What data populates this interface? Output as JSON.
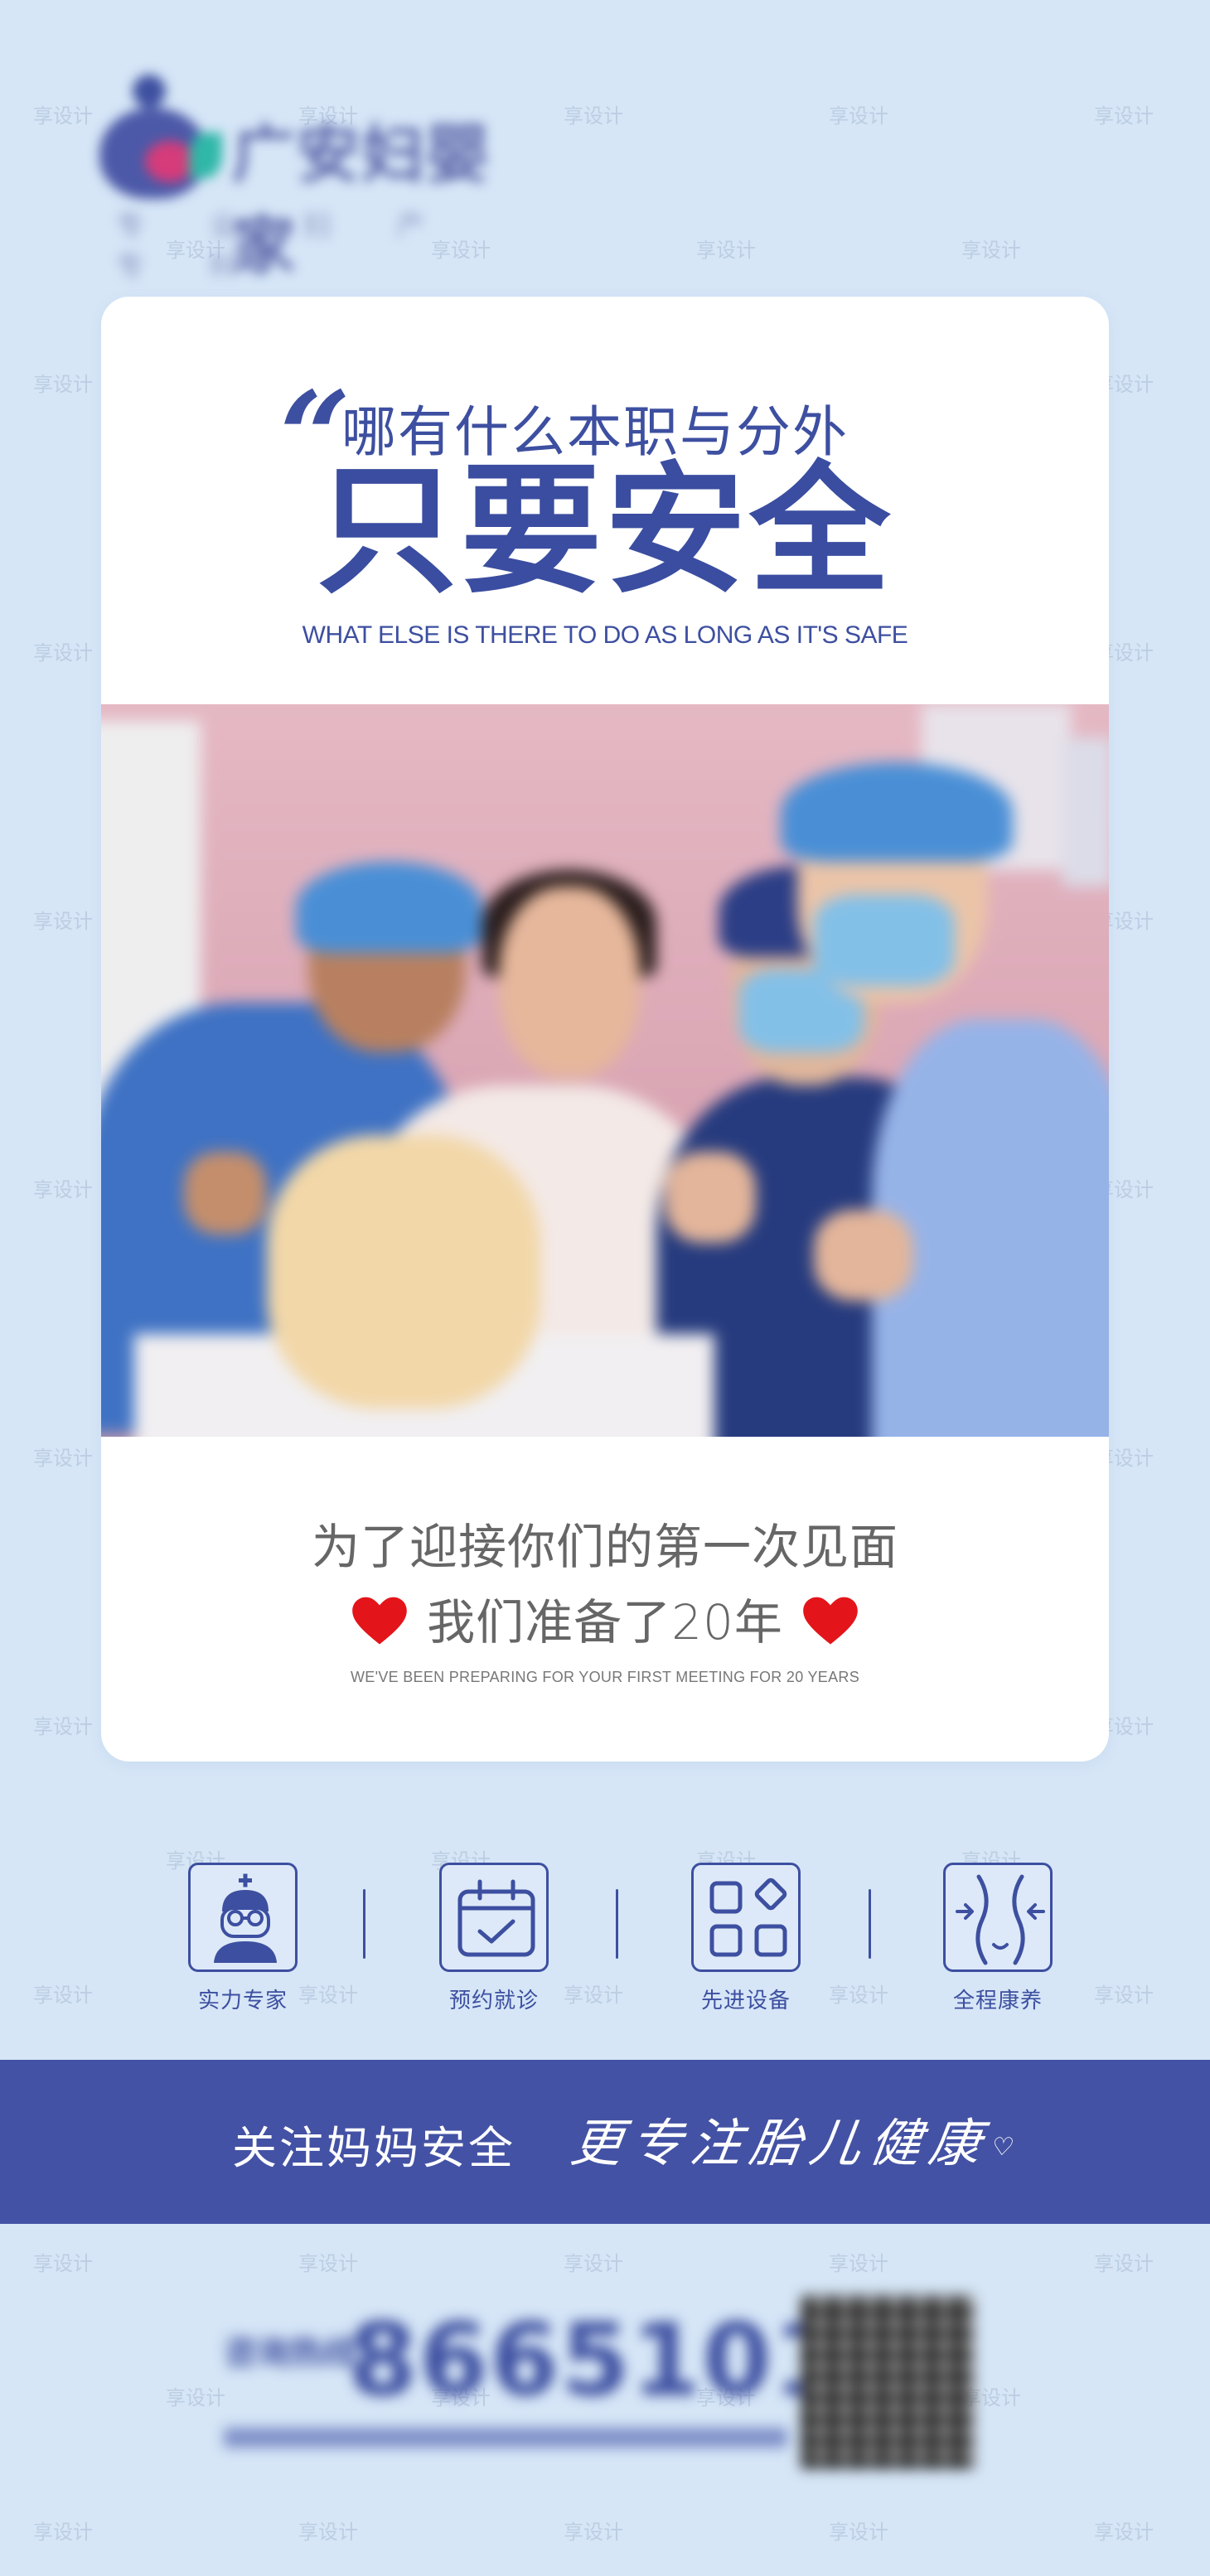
{
  "brand": {
    "name": "广安妇婴家",
    "tagline": "专 业 妇 产 专 科",
    "colors": {
      "primary": "#3d4fa0",
      "background": "#d6e6f7",
      "heart": "#e3151a"
    }
  },
  "watermark": {
    "text": "享设计"
  },
  "card": {
    "quote_mark": "“",
    "subtitle": "哪有什么本职与分外",
    "title": "只要安全",
    "title_en": "WHAT ELSE IS THERE TO DO AS LONG AS IT'S SAFE",
    "photo_alt": "hospital ward photo",
    "line1": "为了迎接你们的第一次见面",
    "line2": "我们准备了20年",
    "line_en": "WE'VE BEEN PREPARING FOR YOUR FIRST MEETING FOR 20 YEARS"
  },
  "features": [
    {
      "icon": "doctor-icon",
      "label": "实力专家"
    },
    {
      "icon": "calendar-icon",
      "label": "预约就诊"
    },
    {
      "icon": "equipment-icon",
      "label": "先进设备"
    },
    {
      "icon": "body-care-icon",
      "label": "全程康养"
    }
  ],
  "banner": {
    "left": "关注妈妈安全",
    "right": "更专注胎儿健康",
    "right_heart": "♡"
  },
  "footer": {
    "phone_prefix": "咨询热线",
    "phone": "8665101"
  }
}
